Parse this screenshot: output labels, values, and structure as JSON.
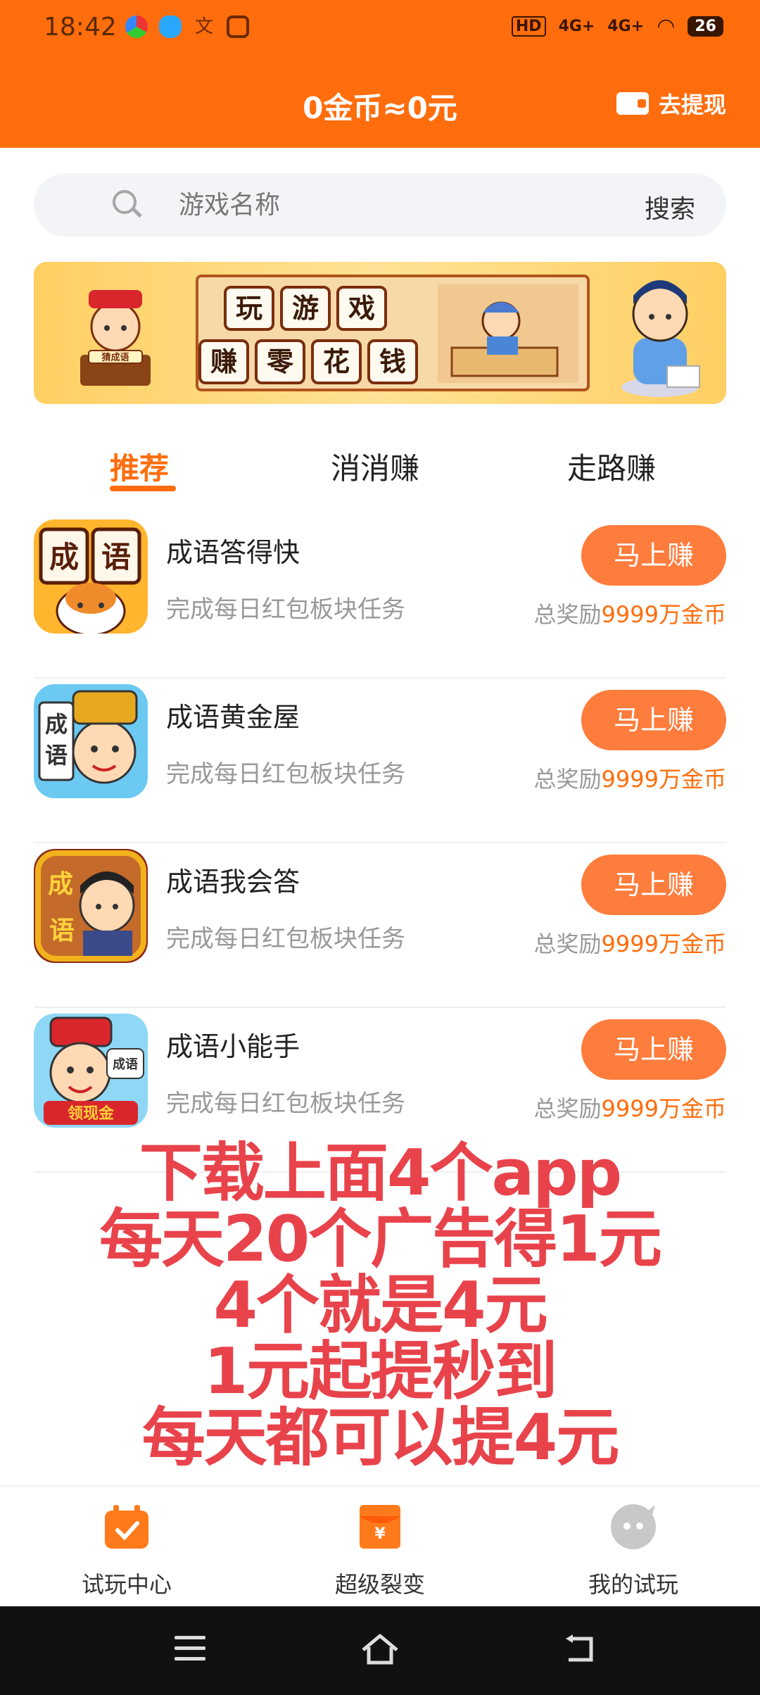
{
  "status_bar": {
    "time": "18:42",
    "hd_badge": "HD",
    "signal1": "4G+",
    "signal2": "4G+",
    "battery": "26"
  },
  "header": {
    "balance": "0金币≈0元",
    "withdraw_label": "去提现"
  },
  "search": {
    "placeholder": "游戏名称",
    "button": "搜索"
  },
  "banner": {
    "line1": [
      "玩",
      "游",
      "戏"
    ],
    "line2": [
      "赚",
      "零",
      "花",
      "钱"
    ],
    "badge": "猜成语"
  },
  "tabs": [
    {
      "label": "推荐",
      "active": true
    },
    {
      "label": "消消赚",
      "active": false
    },
    {
      "label": "走路赚",
      "active": false
    }
  ],
  "games": [
    {
      "name": "成语答得快",
      "desc": "完成每日红包板块任务",
      "button": "马上赚",
      "reward_prefix": "总奖励",
      "reward_amount": "9999万金币",
      "icon_text": "成语"
    },
    {
      "name": "成语黄金屋",
      "desc": "完成每日红包板块任务",
      "button": "马上赚",
      "reward_prefix": "总奖励",
      "reward_amount": "9999万金币",
      "icon_text": "成语"
    },
    {
      "name": "成语我会答",
      "desc": "完成每日红包板块任务",
      "button": "马上赚",
      "reward_prefix": "总奖励",
      "reward_amount": "9999万金币",
      "icon_text": "成语"
    },
    {
      "name": "成语小能手",
      "desc": "完成每日红包板块任务",
      "button": "马上赚",
      "reward_prefix": "总奖励",
      "reward_amount": "9999万金币",
      "icon_text": "成语",
      "icon_badge": "领现金"
    }
  ],
  "promo_lines": [
    "下载上面4个app",
    "每天20个广告得1元",
    "4个就是4元",
    "1元起提秒到",
    "每天都可以提4元"
  ],
  "bottom_nav": [
    {
      "label": "试玩中心",
      "icon": "calendar-check-icon"
    },
    {
      "label": "超级裂变",
      "icon": "red-envelope-icon"
    },
    {
      "label": "我的试玩",
      "icon": "chat-bubble-icon"
    }
  ],
  "colors": {
    "primary": "#ff6d0d",
    "button": "#fe7d3d",
    "promo_text": "#e8434b"
  }
}
